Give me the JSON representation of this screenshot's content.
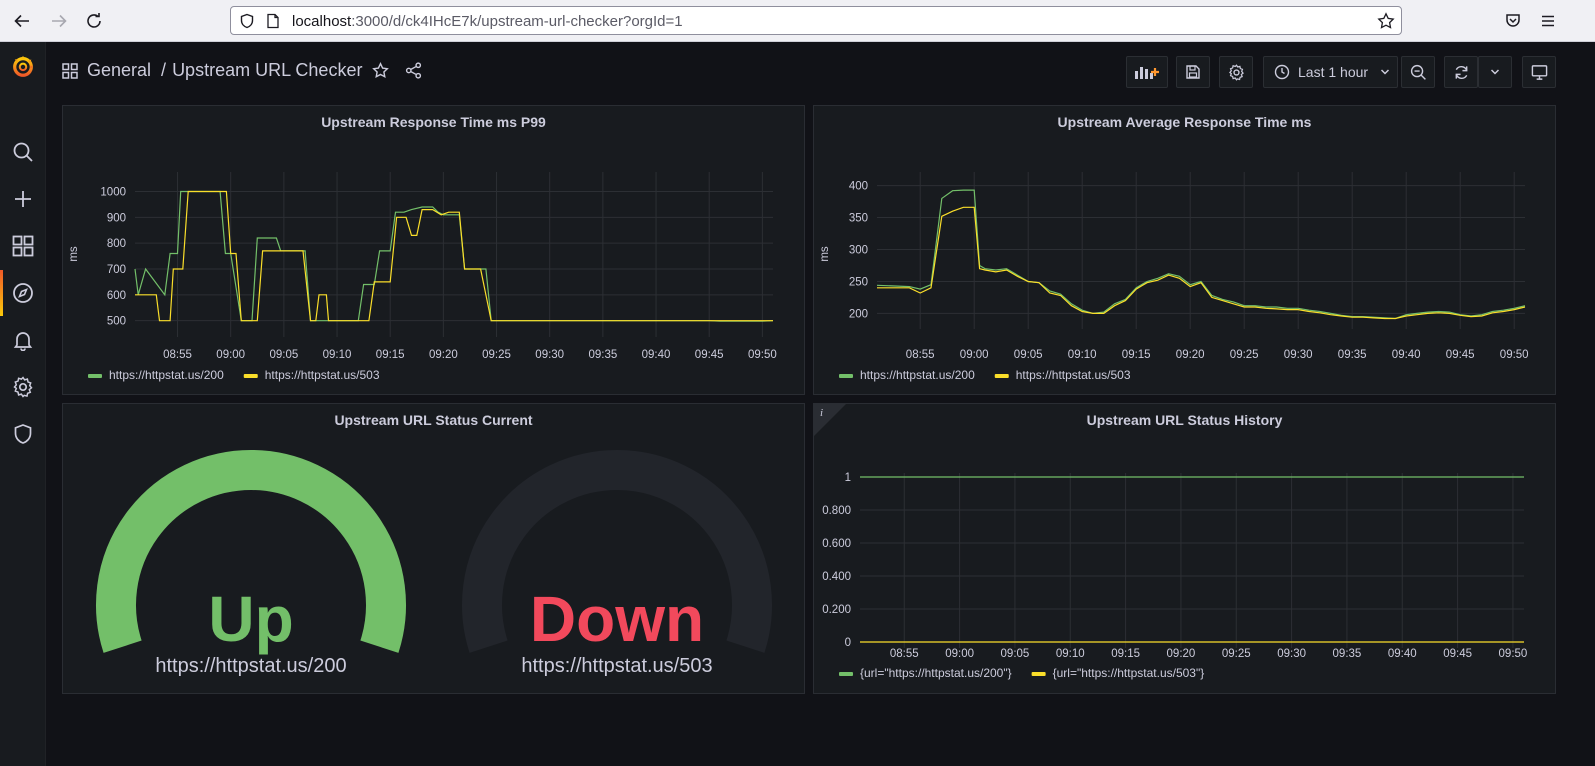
{
  "browser": {
    "url_host": "localhost",
    "url_path": ":3000/d/ck4IHcE7k/upstream-url-checker?orgId=1"
  },
  "breadcrumb": {
    "folder": "General",
    "separator": "/",
    "title": "Upstream URL Checker"
  },
  "toolbar": {
    "time_range": "Last 1 hour"
  },
  "colors": {
    "green": "#73bf69",
    "yellow": "#fade2a",
    "red": "#f2495c",
    "panel_bg": "#181b1f",
    "page_bg": "#111217"
  },
  "panels": {
    "p99": {
      "title": "Upstream Response Time ms P99",
      "legend": [
        "https://httpstat.us/200",
        "https://httpstat.us/503"
      ]
    },
    "avg": {
      "title": "Upstream Average Response Time ms",
      "legend": [
        "https://httpstat.us/200",
        "https://httpstat.us/503"
      ]
    },
    "current": {
      "title": "Upstream URL Status Current",
      "gauges": [
        {
          "value": "Up",
          "label": "https://httpstat.us/200",
          "color": "#73bf69",
          "fill": 1
        },
        {
          "value": "Down",
          "label": "https://httpstat.us/503",
          "color": "#f2495c",
          "fill": 0
        }
      ]
    },
    "history": {
      "title": "Upstream URL Status History",
      "info": "i",
      "legend": [
        "{url=\"https://httpstat.us/200\"}",
        "{url=\"https://httpstat.us/503\"}"
      ]
    }
  },
  "chart_data": [
    {
      "type": "line",
      "title": "Upstream Response Time ms P99",
      "ylabel": "ms",
      "x_ticks": [
        "08:55",
        "09:00",
        "09:05",
        "09:10",
        "09:15",
        "09:20",
        "09:25",
        "09:30",
        "09:35",
        "09:40",
        "09:45",
        "09:50"
      ],
      "x_range": [
        "08:51",
        "09:51"
      ],
      "ylim": [
        460,
        1060
      ],
      "y_ticks": [
        500,
        600,
        700,
        800,
        900,
        1000
      ],
      "legend_position": "bottom-left",
      "series": [
        {
          "name": "https://httpstat.us/200",
          "color": "#73bf69",
          "points": [
            [
              "08:51",
              700
            ],
            [
              "08:51.3",
              600
            ],
            [
              "08:52",
              700
            ],
            [
              "08:53.8",
              600
            ],
            [
              "08:54.3",
              760
            ],
            [
              "08:55",
              760
            ],
            [
              "08:55.3",
              1000
            ],
            [
              "08:59",
              1000
            ],
            [
              "08:59.5",
              760
            ],
            [
              "09:00",
              760
            ],
            [
              "09:01",
              500
            ],
            [
              "09:02",
              500
            ],
            [
              "09:02.5",
              820
            ],
            [
              "09:04.3",
              820
            ],
            [
              "09:04.7",
              770
            ],
            [
              "09:07",
              770
            ],
            [
              "09:07.5",
              500
            ],
            [
              "09:12",
              500
            ],
            [
              "09:12.5",
              640
            ],
            [
              "09:13.5",
              640
            ],
            [
              "09:14",
              770
            ],
            [
              "09:15",
              770
            ],
            [
              "09:15.5",
              920
            ],
            [
              "09:16.3",
              920
            ],
            [
              "09:17",
              930
            ],
            [
              "09:18",
              940
            ],
            [
              "09:19",
              940
            ],
            [
              "09:19.5",
              920
            ],
            [
              "09:20",
              910
            ],
            [
              "09:21.5",
              910
            ],
            [
              "09:22",
              700
            ],
            [
              "09:24",
              700
            ],
            [
              "09:24.5",
              500
            ],
            [
              "09:45",
              500
            ],
            [
              "09:46",
              498
            ],
            [
              "09:50",
              498
            ],
            [
              "09:51",
              500
            ]
          ]
        },
        {
          "name": "https://httpstat.us/503",
          "color": "#fade2a",
          "points": [
            [
              "08:51",
              600
            ],
            [
              "08:53",
              600
            ],
            [
              "08:53.3",
              500
            ],
            [
              "08:54.3",
              500
            ],
            [
              "08:54.6",
              700
            ],
            [
              "08:55.5",
              700
            ],
            [
              "08:56",
              1000
            ],
            [
              "08:59.6",
              1000
            ],
            [
              "08:60",
              760
            ],
            [
              "09:00.5",
              760
            ],
            [
              "09:01",
              500
            ],
            [
              "09:02.5",
              500
            ],
            [
              "09:03",
              770
            ],
            [
              "09:06.8",
              770
            ],
            [
              "09:07.5",
              500
            ],
            [
              "09:08",
              500
            ],
            [
              "09:08.3",
              600
            ],
            [
              "09:09",
              600
            ],
            [
              "09:09.2",
              500
            ],
            [
              "09:13",
              500
            ],
            [
              "09:13.5",
              650
            ],
            [
              "09:15",
              650
            ],
            [
              "09:15.6",
              900
            ],
            [
              "09:16.5",
              900
            ],
            [
              "09:17",
              830
            ],
            [
              "09:17.5",
              830
            ],
            [
              "09:18",
              930
            ],
            [
              "09:19",
              930
            ],
            [
              "09:19.8",
              910
            ],
            [
              "09:20.5",
              920
            ],
            [
              "09:21.5",
              920
            ],
            [
              "09:22",
              700
            ],
            [
              "09:23.5",
              700
            ],
            [
              "09:24.5",
              500
            ],
            [
              "09:51",
              500
            ]
          ]
        }
      ]
    },
    {
      "type": "line",
      "title": "Upstream Average Response Time ms",
      "ylabel": "ms",
      "x_ticks": [
        "08:55",
        "09:00",
        "09:05",
        "09:10",
        "09:15",
        "09:20",
        "09:25",
        "09:30",
        "09:35",
        "09:40",
        "09:45",
        "09:50"
      ],
      "x_range": [
        "08:51",
        "09:51"
      ],
      "ylim": [
        185,
        415
      ],
      "y_ticks": [
        200,
        250,
        300,
        350,
        400
      ],
      "legend_position": "bottom-left",
      "series": [
        {
          "name": "https://httpstat.us/200",
          "color": "#73bf69",
          "points": [
            [
              "08:51",
              244
            ],
            [
              "08:54",
              242
            ],
            [
              "08:55",
              238
            ],
            [
              "08:56",
              245
            ],
            [
              "08:57",
              380
            ],
            [
              "08:58",
              392
            ],
            [
              "08:59",
              393
            ],
            [
              "09:00",
              393
            ],
            [
              "09:00.5",
              275
            ],
            [
              "09:01",
              270
            ],
            [
              "09:02",
              268
            ],
            [
              "09:03",
              270
            ],
            [
              "09:04",
              260
            ],
            [
              "09:05",
              250
            ],
            [
              "09:06",
              248
            ],
            [
              "09:07",
              235
            ],
            [
              "09:08",
              230
            ],
            [
              "09:09",
              215
            ],
            [
              "09:10",
              205
            ],
            [
              "09:11",
              200
            ],
            [
              "09:12",
              202
            ],
            [
              "09:13",
              215
            ],
            [
              "09:14",
              222
            ],
            [
              "09:15",
              240
            ],
            [
              "09:16",
              250
            ],
            [
              "09:17",
              255
            ],
            [
              "09:18",
              262
            ],
            [
              "09:19",
              258
            ],
            [
              "09:20",
              245
            ],
            [
              "09:21",
              250
            ],
            [
              "09:22",
              228
            ],
            [
              "09:23",
              222
            ],
            [
              "09:24",
              218
            ],
            [
              "09:25",
              212
            ],
            [
              "09:26",
              212
            ],
            [
              "09:27",
              210
            ],
            [
              "09:28",
              210
            ],
            [
              "09:29",
              208
            ],
            [
              "09:30",
              208
            ],
            [
              "09:31",
              205
            ],
            [
              "09:32",
              203
            ],
            [
              "09:33",
              200
            ],
            [
              "09:34",
              197
            ],
            [
              "09:35",
              195
            ],
            [
              "09:36",
              195
            ],
            [
              "09:37",
              194
            ],
            [
              "09:38",
              193
            ],
            [
              "09:39",
              192
            ],
            [
              "09:40",
              198
            ],
            [
              "09:41",
              200
            ],
            [
              "09:42",
              202
            ],
            [
              "09:43",
              203
            ],
            [
              "09:44",
              202
            ],
            [
              "09:45",
              198
            ],
            [
              "09:46",
              196
            ],
            [
              "09:47",
              198
            ],
            [
              "09:48",
              203
            ],
            [
              "09:49",
              205
            ],
            [
              "09:50",
              208
            ],
            [
              "09:51",
              212
            ]
          ]
        },
        {
          "name": "https://httpstat.us/503",
          "color": "#fade2a",
          "points": [
            [
              "08:51",
              240
            ],
            [
              "08:54",
              240
            ],
            [
              "08:55",
              232
            ],
            [
              "08:56",
              240
            ],
            [
              "08:57",
              352
            ],
            [
              "08:58",
              360
            ],
            [
              "08:59",
              366
            ],
            [
              "09:00",
              366
            ],
            [
              "09:00.5",
              270
            ],
            [
              "09:01",
              268
            ],
            [
              "09:02",
              265
            ],
            [
              "09:03",
              268
            ],
            [
              "09:04",
              258
            ],
            [
              "09:05",
              250
            ],
            [
              "09:06",
              248
            ],
            [
              "09:07",
              232
            ],
            [
              "09:08",
              228
            ],
            [
              "09:09",
              212
            ],
            [
              "09:10",
              203
            ],
            [
              "09:11",
              200
            ],
            [
              "09:12",
              200
            ],
            [
              "09:13",
              212
            ],
            [
              "09:14",
              220
            ],
            [
              "09:15",
              238
            ],
            [
              "09:16",
              248
            ],
            [
              "09:17",
              252
            ],
            [
              "09:18",
              260
            ],
            [
              "09:19",
              255
            ],
            [
              "09:20",
              242
            ],
            [
              "09:21",
              248
            ],
            [
              "09:22",
              225
            ],
            [
              "09:23",
              220
            ],
            [
              "09:24",
              215
            ],
            [
              "09:25",
              210
            ],
            [
              "09:26",
              210
            ],
            [
              "09:27",
              208
            ],
            [
              "09:28",
              207
            ],
            [
              "09:29",
              206
            ],
            [
              "09:30",
              206
            ],
            [
              "09:31",
              203
            ],
            [
              "09:32",
              201
            ],
            [
              "09:33",
              198
            ],
            [
              "09:34",
              196
            ],
            [
              "09:35",
              194
            ],
            [
              "09:36",
              194
            ],
            [
              "09:37",
              193
            ],
            [
              "09:38",
              192
            ],
            [
              "09:39",
              192
            ],
            [
              "09:40",
              196
            ],
            [
              "09:41",
              198
            ],
            [
              "09:42",
              200
            ],
            [
              "09:43",
              201
            ],
            [
              "09:44",
              200
            ],
            [
              "09:45",
              197
            ],
            [
              "09:46",
              195
            ],
            [
              "09:47",
              196
            ],
            [
              "09:48",
              201
            ],
            [
              "09:49",
              203
            ],
            [
              "09:50",
              206
            ],
            [
              "09:51",
              210
            ]
          ]
        }
      ]
    },
    {
      "type": "line",
      "title": "Upstream URL Status History",
      "x_ticks": [
        "08:55",
        "09:00",
        "09:05",
        "09:10",
        "09:15",
        "09:20",
        "09:25",
        "09:30",
        "09:35",
        "09:40",
        "09:45",
        "09:50"
      ],
      "x_range": [
        "08:51",
        "09:51"
      ],
      "ylim": [
        0,
        1
      ],
      "y_ticks": [
        "0",
        "0.200",
        "0.400",
        "0.600",
        "0.800",
        "1"
      ],
      "legend_position": "bottom-left",
      "series": [
        {
          "name": "{url=\"https://httpstat.us/200\"}",
          "color": "#73bf69",
          "points": [
            [
              "08:51",
              1
            ],
            [
              "09:51",
              1
            ]
          ]
        },
        {
          "name": "{url=\"https://httpstat.us/503\"}",
          "color": "#fade2a",
          "points": [
            [
              "08:51",
              0
            ],
            [
              "09:51",
              0
            ]
          ]
        }
      ]
    }
  ]
}
